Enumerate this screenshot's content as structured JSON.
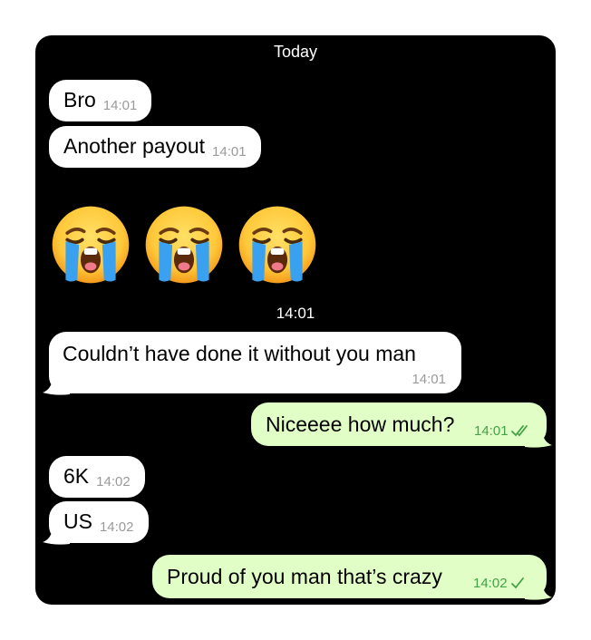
{
  "chat": {
    "date_separator": "Today",
    "emoji_time": "14:01",
    "emoji_icon": "loudly-crying-face",
    "messages": [
      {
        "text": "Bro",
        "time": "14:01",
        "direction": "incoming"
      },
      {
        "text": "Another payout",
        "time": "14:01",
        "direction": "incoming"
      },
      {
        "text": "Couldn’t have done it without you man",
        "time": "14:01",
        "direction": "incoming"
      },
      {
        "text": "Niceeee how much?",
        "time": "14:01",
        "direction": "outgoing",
        "status": "read"
      },
      {
        "text": "6K",
        "time": "14:02",
        "direction": "incoming"
      },
      {
        "text": "US",
        "time": "14:02",
        "direction": "incoming"
      },
      {
        "text": "Proud of you man that’s crazy",
        "time": "14:02",
        "direction": "outgoing",
        "status": "delivered"
      }
    ]
  },
  "colors": {
    "background": "#000000",
    "incoming_bubble": "#ffffff",
    "outgoing_bubble": "#e1fec6",
    "outgoing_time": "#43a245",
    "incoming_time": "#9a9a9a"
  }
}
